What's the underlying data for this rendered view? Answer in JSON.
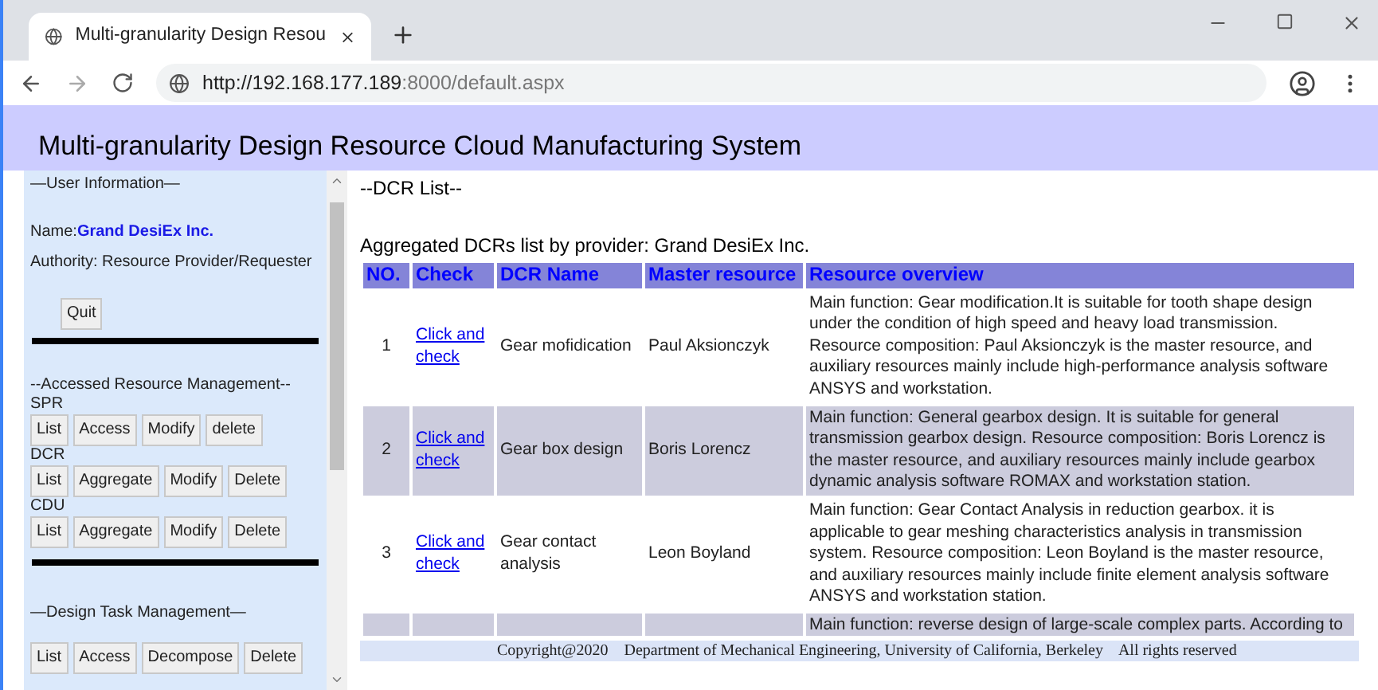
{
  "browser": {
    "tab_title": "Multi-granularity Design Resou",
    "url_host": "http://192.168.177.189",
    "url_path": ":8000/default.aspx"
  },
  "header": {
    "title": "Multi-granularity Design Resource Cloud Manufacturing System"
  },
  "sidebar": {
    "user_heading": "—User Information—",
    "name_label": "Name:",
    "name_value": "Grand DesiEx Inc.",
    "authority": "Authority: Resource Provider/Requester",
    "quit": "Quit",
    "resource_heading": "--Accessed Resource Management--",
    "groups": [
      {
        "label": "SPR",
        "buttons": [
          "List",
          "Access",
          "Modify",
          "delete"
        ]
      },
      {
        "label": "DCR",
        "buttons": [
          "List",
          "Aggregate",
          "Modify",
          "Delete"
        ]
      },
      {
        "label": "CDU",
        "buttons": [
          "List",
          "Aggregate",
          "Modify",
          "Delete"
        ]
      }
    ],
    "task_heading": "—Design Task Management—",
    "task_buttons": [
      "List",
      "Access",
      "Decompose",
      "Delete"
    ]
  },
  "main": {
    "title": "--DCR List--",
    "subtitle": "Aggregated DCRs list by provider: Grand DesiEx Inc.",
    "table": {
      "columns": [
        "NO.",
        "Check",
        "DCR Name",
        "Master resource",
        "Resource overview"
      ],
      "rows": [
        {
          "no": "1",
          "check": "Click and check",
          "name": "Gear mofidication",
          "master": "Paul Aksionczyk",
          "overview": "Main function: Gear modification.It is suitable for tooth shape design under the condition of high speed and heavy load transmission. Resource composition: Paul Aksionczyk is the master resource, and auxiliary resources mainly include high-performance analysis software ANSYS and workstation."
        },
        {
          "no": "2",
          "check": "Click and check",
          "name": "Gear box design",
          "master": "Boris Lorencz",
          "overview": "Main function: General gearbox design. It is suitable for general transmission gearbox design. Resource composition: Boris Lorencz is the master resource, and auxiliary resources mainly include gearbox dynamic analysis software ROMAX and workstation station."
        },
        {
          "no": "3",
          "check": "Click and check",
          "name": "Gear contact analysis",
          "master": "Leon Boyland",
          "overview": "Main function: Gear Contact Analysis in reduction gearbox. it is applicable to gear meshing characteristics analysis in transmission system. Resource composition: Leon Boyland is the master resource, and auxiliary resources mainly include finite element analysis software ANSYS and workstation station."
        },
        {
          "overview": "Main function: reverse design of large-scale complex parts. According to"
        }
      ]
    }
  },
  "footer": {
    "text": "Copyright@2020    Department of Mechanical Engineering, University of California, Berkeley    All rights reserved"
  }
}
